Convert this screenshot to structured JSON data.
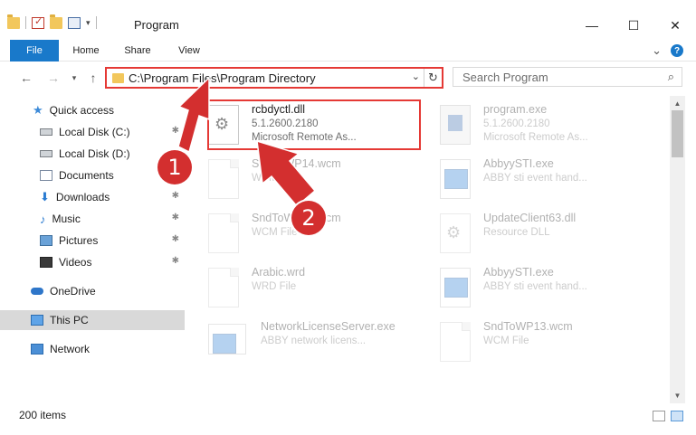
{
  "window": {
    "title": "Program",
    "minimize": "—",
    "maximize": "☐",
    "close": "✕"
  },
  "ribbon": {
    "tabs": [
      "File",
      "Home",
      "Share",
      "View"
    ],
    "expand": "⌄",
    "help": "?"
  },
  "nav": {
    "back": "←",
    "forward": "→",
    "recent": "▾",
    "up": "↑",
    "address": "C:\\Program Files\\Program Directory",
    "address_dropdown": "⌄",
    "refresh": "↻",
    "search_placeholder": "Search Program",
    "search_icon": "⌕"
  },
  "sidebar": {
    "items": [
      {
        "label": "Quick access",
        "icon": "star-icon"
      },
      {
        "label": "Local Disk (C:)",
        "icon": "drive-icon",
        "pinned": true
      },
      {
        "label": "Local Disk (D:)",
        "icon": "drive-icon"
      },
      {
        "label": "Documents",
        "icon": "documents-icon",
        "pinned": true
      },
      {
        "label": "Downloads",
        "icon": "download-icon",
        "pinned": true
      },
      {
        "label": "Music",
        "icon": "music-icon",
        "pinned": true
      },
      {
        "label": "Pictures",
        "icon": "pictures-icon",
        "pinned": true
      },
      {
        "label": "Videos",
        "icon": "videos-icon",
        "pinned": true
      },
      {
        "label": "OneDrive",
        "icon": "cloud-icon"
      },
      {
        "label": "This PC",
        "icon": "computer-icon",
        "selected": true
      },
      {
        "label": "Network",
        "icon": "network-icon"
      }
    ],
    "pin_glyph": "📌"
  },
  "files": [
    {
      "name": "rcbdyctl.dll",
      "line2": "5.1.2600.2180",
      "line3": "Microsoft Remote As...",
      "icon": "gear"
    },
    {
      "name": "program.exe",
      "line2": "5.1.2600.2180",
      "line3": "Microsoft Remote As...",
      "icon": "pkg"
    },
    {
      "name": "SndToWP14.wcm",
      "line2": "WCM File",
      "line3": "",
      "icon": "doc"
    },
    {
      "name": "AbbyySTI.exe",
      "line2": "ABBY sti event hand...",
      "line3": "",
      "icon": "exe"
    },
    {
      "name": "SndToWP13.wcm",
      "line2": "WCM File",
      "line3": "",
      "icon": "doc"
    },
    {
      "name": "UpdateClient63.dll",
      "line2": "Resource DLL",
      "line3": "",
      "icon": "gear"
    },
    {
      "name": "Arabic.wrd",
      "line2": "WRD File",
      "line3": "",
      "icon": "doc"
    },
    {
      "name": "AbbyySTI.exe",
      "line2": "ABBY sti event hand...",
      "line3": "",
      "icon": "exe"
    },
    {
      "name": "NetworkLicenseServer.exe",
      "line2": "ABBY network licens...",
      "line3": "",
      "icon": "exe"
    },
    {
      "name": "SndToWP13.wcm",
      "line2": "WCM File",
      "line3": "",
      "icon": "doc"
    }
  ],
  "status": {
    "count": "200 items"
  },
  "annotations": {
    "badge1": "1",
    "badge2": "2"
  },
  "colors": {
    "accent": "#1979ca",
    "annotation_red": "#d32f2f",
    "highlight_border": "#e53935"
  }
}
